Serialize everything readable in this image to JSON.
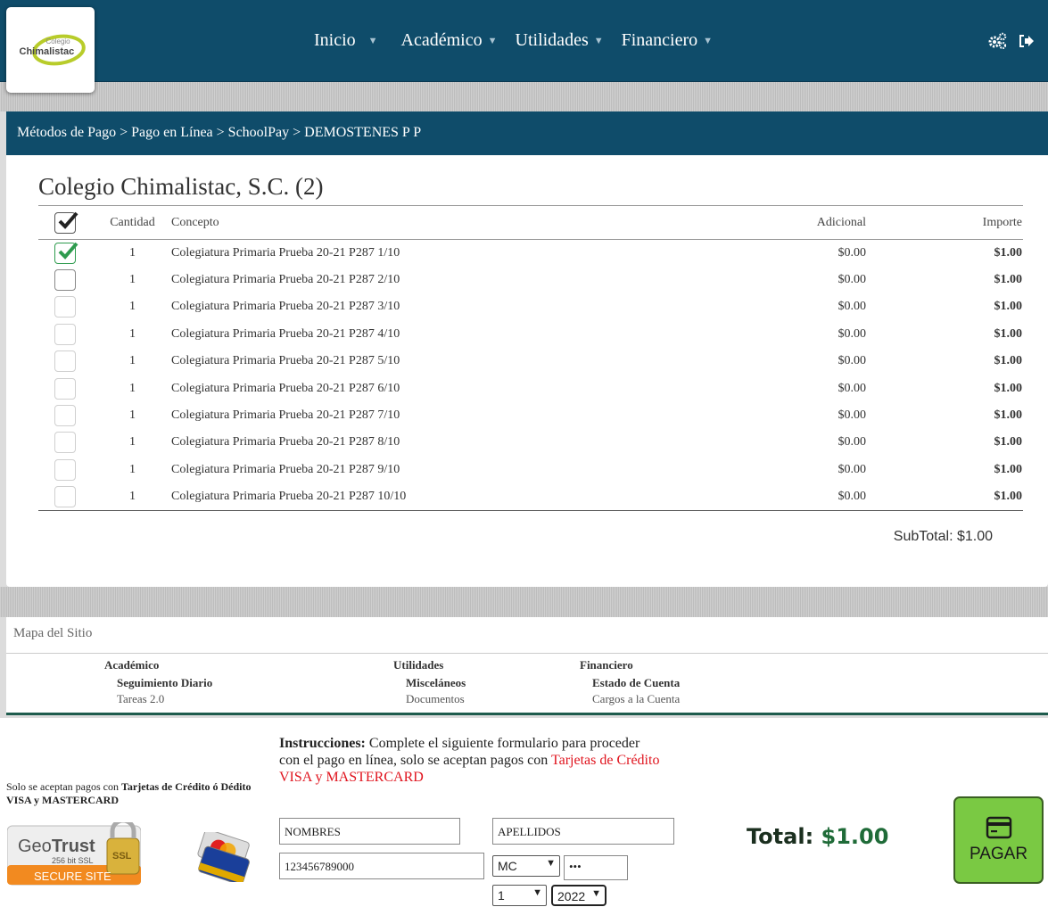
{
  "header": {
    "logo_small": "Colegio",
    "logo_big": "Chimalistac",
    "nav": [
      {
        "label": "Inicio"
      },
      {
        "label": "Académico"
      },
      {
        "label": "Utilidades"
      },
      {
        "label": "Financiero"
      }
    ],
    "icons": [
      "settings-gears-icon",
      "logout-icon"
    ]
  },
  "breadcrumb": "Métodos de Pago > Pago en Línea > SchoolPay > DEMOSTENES P P",
  "school": {
    "title": "Colegio Chimalistac, S.C. (2)"
  },
  "table": {
    "headers": {
      "cantidad": "Cantidad",
      "concepto": "Concepto",
      "adicional": "Adicional",
      "importe": "Importe"
    },
    "rows": [
      {
        "qty": "1",
        "concept": "Colegiatura Primaria Prueba 20-21 P287 1/10",
        "add": "$0.00",
        "imp": "$1.00",
        "checked": true
      },
      {
        "qty": "1",
        "concept": "Colegiatura Primaria Prueba 20-21 P287 2/10",
        "add": "$0.00",
        "imp": "$1.00",
        "checked": false
      },
      {
        "qty": "1",
        "concept": "Colegiatura Primaria Prueba 20-21 P287 3/10",
        "add": "$0.00",
        "imp": "$1.00",
        "checked": false
      },
      {
        "qty": "1",
        "concept": "Colegiatura Primaria Prueba 20-21 P287 4/10",
        "add": "$0.00",
        "imp": "$1.00",
        "checked": false
      },
      {
        "qty": "1",
        "concept": "Colegiatura Primaria Prueba 20-21 P287 5/10",
        "add": "$0.00",
        "imp": "$1.00",
        "checked": false
      },
      {
        "qty": "1",
        "concept": "Colegiatura Primaria Prueba 20-21 P287 6/10",
        "add": "$0.00",
        "imp": "$1.00",
        "checked": false
      },
      {
        "qty": "1",
        "concept": "Colegiatura Primaria Prueba 20-21 P287 7/10",
        "add": "$0.00",
        "imp": "$1.00",
        "checked": false
      },
      {
        "qty": "1",
        "concept": "Colegiatura Primaria Prueba 20-21 P287 8/10",
        "add": "$0.00",
        "imp": "$1.00",
        "checked": false
      },
      {
        "qty": "1",
        "concept": "Colegiatura Primaria Prueba 20-21 P287 9/10",
        "add": "$0.00",
        "imp": "$1.00",
        "checked": false
      },
      {
        "qty": "1",
        "concept": "Colegiatura Primaria Prueba 20-21 P287 10/10",
        "add": "$0.00",
        "imp": "$1.00",
        "checked": false
      }
    ],
    "subtotal": "SubTotal: $1.00"
  },
  "sitemap": {
    "title": "Mapa del Sitio",
    "cols": [
      {
        "heading": "Académico",
        "sub": "Seguimiento Diario",
        "link": "Tareas 2.0"
      },
      {
        "heading": "Utilidades",
        "sub": "Misceláneos",
        "link": "Documentos"
      },
      {
        "heading": "Financiero",
        "sub": "Estado de Cuenta",
        "link": "Cargos a la Cuenta"
      }
    ]
  },
  "payment": {
    "note_prefix": "Solo se aceptan pagos con ",
    "note_bold": "Tarjetas de Crédito ó Dédito VISA y MASTERCARD",
    "geotrust_brand_a": "Geo",
    "geotrust_brand_b": "Trust",
    "geotrust_sub": "256 bit SSL",
    "geotrust_secure": "SECURE SITE",
    "geotrust_ssl": "SSL",
    "instr_bold": "Instrucciones:",
    "instr_text": " Complete el siguiente formulario para proceder con el pago en línea, solo se aceptan pagos con ",
    "instr_red": "Tarjetas de Crédito VISA y MASTERCARD",
    "first_name": "NOMBRES",
    "last_name": "APELLIDOS",
    "card_number": "123456789000",
    "card_type": "MC",
    "cvv": "•••",
    "month": "1",
    "year": "2022",
    "total_label": "Total: ",
    "total_amount": "$1.00",
    "pay_button": "PAGAR"
  }
}
